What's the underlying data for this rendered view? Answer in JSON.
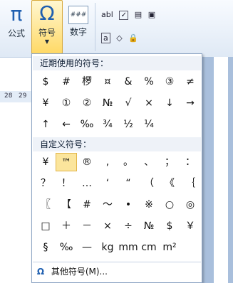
{
  "ribbon": {
    "formula_label": "公式",
    "symbol_label": "符号",
    "number_label": "数字",
    "abl_label": "abl"
  },
  "ruler": {
    "marks": [
      "28",
      "29"
    ]
  },
  "dropdown": {
    "recent_title": "近期使用的符号：",
    "recent_symbols": [
      "$",
      "#",
      "椤",
      "¤",
      "&",
      "%",
      "③",
      "≠",
      "¥",
      "①",
      "②",
      "№",
      "√",
      "×",
      "↓",
      "→",
      "↑",
      "←",
      "‰",
      "¾",
      "½",
      "¼"
    ],
    "custom_title": "自定义符号：",
    "custom_symbols": [
      "¥",
      "™",
      "®",
      ",",
      "。",
      "、",
      "；",
      "：",
      "？",
      "！",
      "…",
      "‘",
      "“",
      "（",
      "《",
      "｛",
      "〖",
      "【",
      "#",
      "～",
      "•",
      "※",
      "○",
      "◎",
      "□",
      "＋",
      "－",
      "×",
      "÷",
      "№",
      "$",
      "￥",
      "§",
      "‰",
      "—",
      "kg",
      "mm",
      "cm",
      "m²"
    ],
    "more_label": "其他符号(M)..."
  }
}
